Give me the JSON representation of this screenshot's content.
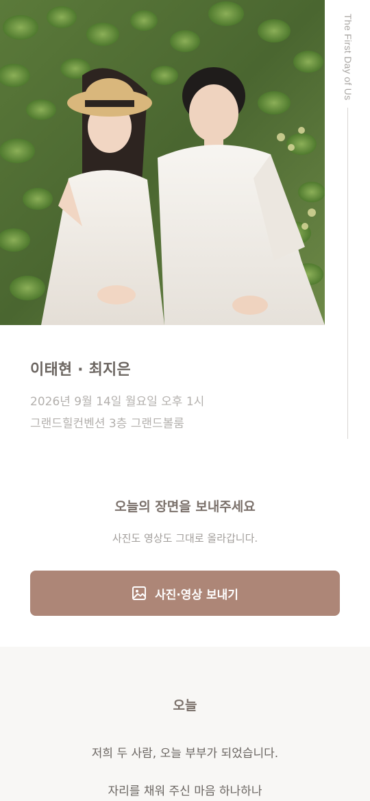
{
  "hero": {
    "vertical_caption": "The First Day of Us"
  },
  "couple": {
    "names": "이태현 · 최지은",
    "date": "2026년 9월 14일 월요일 오후 1시",
    "venue": "그랜드힐컨벤션 3층 그랜드볼룸"
  },
  "share": {
    "title": "오늘의 장면을 보내주세요",
    "subtitle": "사진도 영상도 그대로 올라갑니다.",
    "button_label": "사진·영상 보내기",
    "button_icon": "image-icon",
    "accent_color": "#ad8677"
  },
  "greeting": {
    "title": "오늘",
    "lines": [
      "저희 두 사람, 오늘 부부가 되었습니다.",
      "자리를 채워 주신 마음 하나하나"
    ],
    "background_color": "#f8f7f5"
  }
}
